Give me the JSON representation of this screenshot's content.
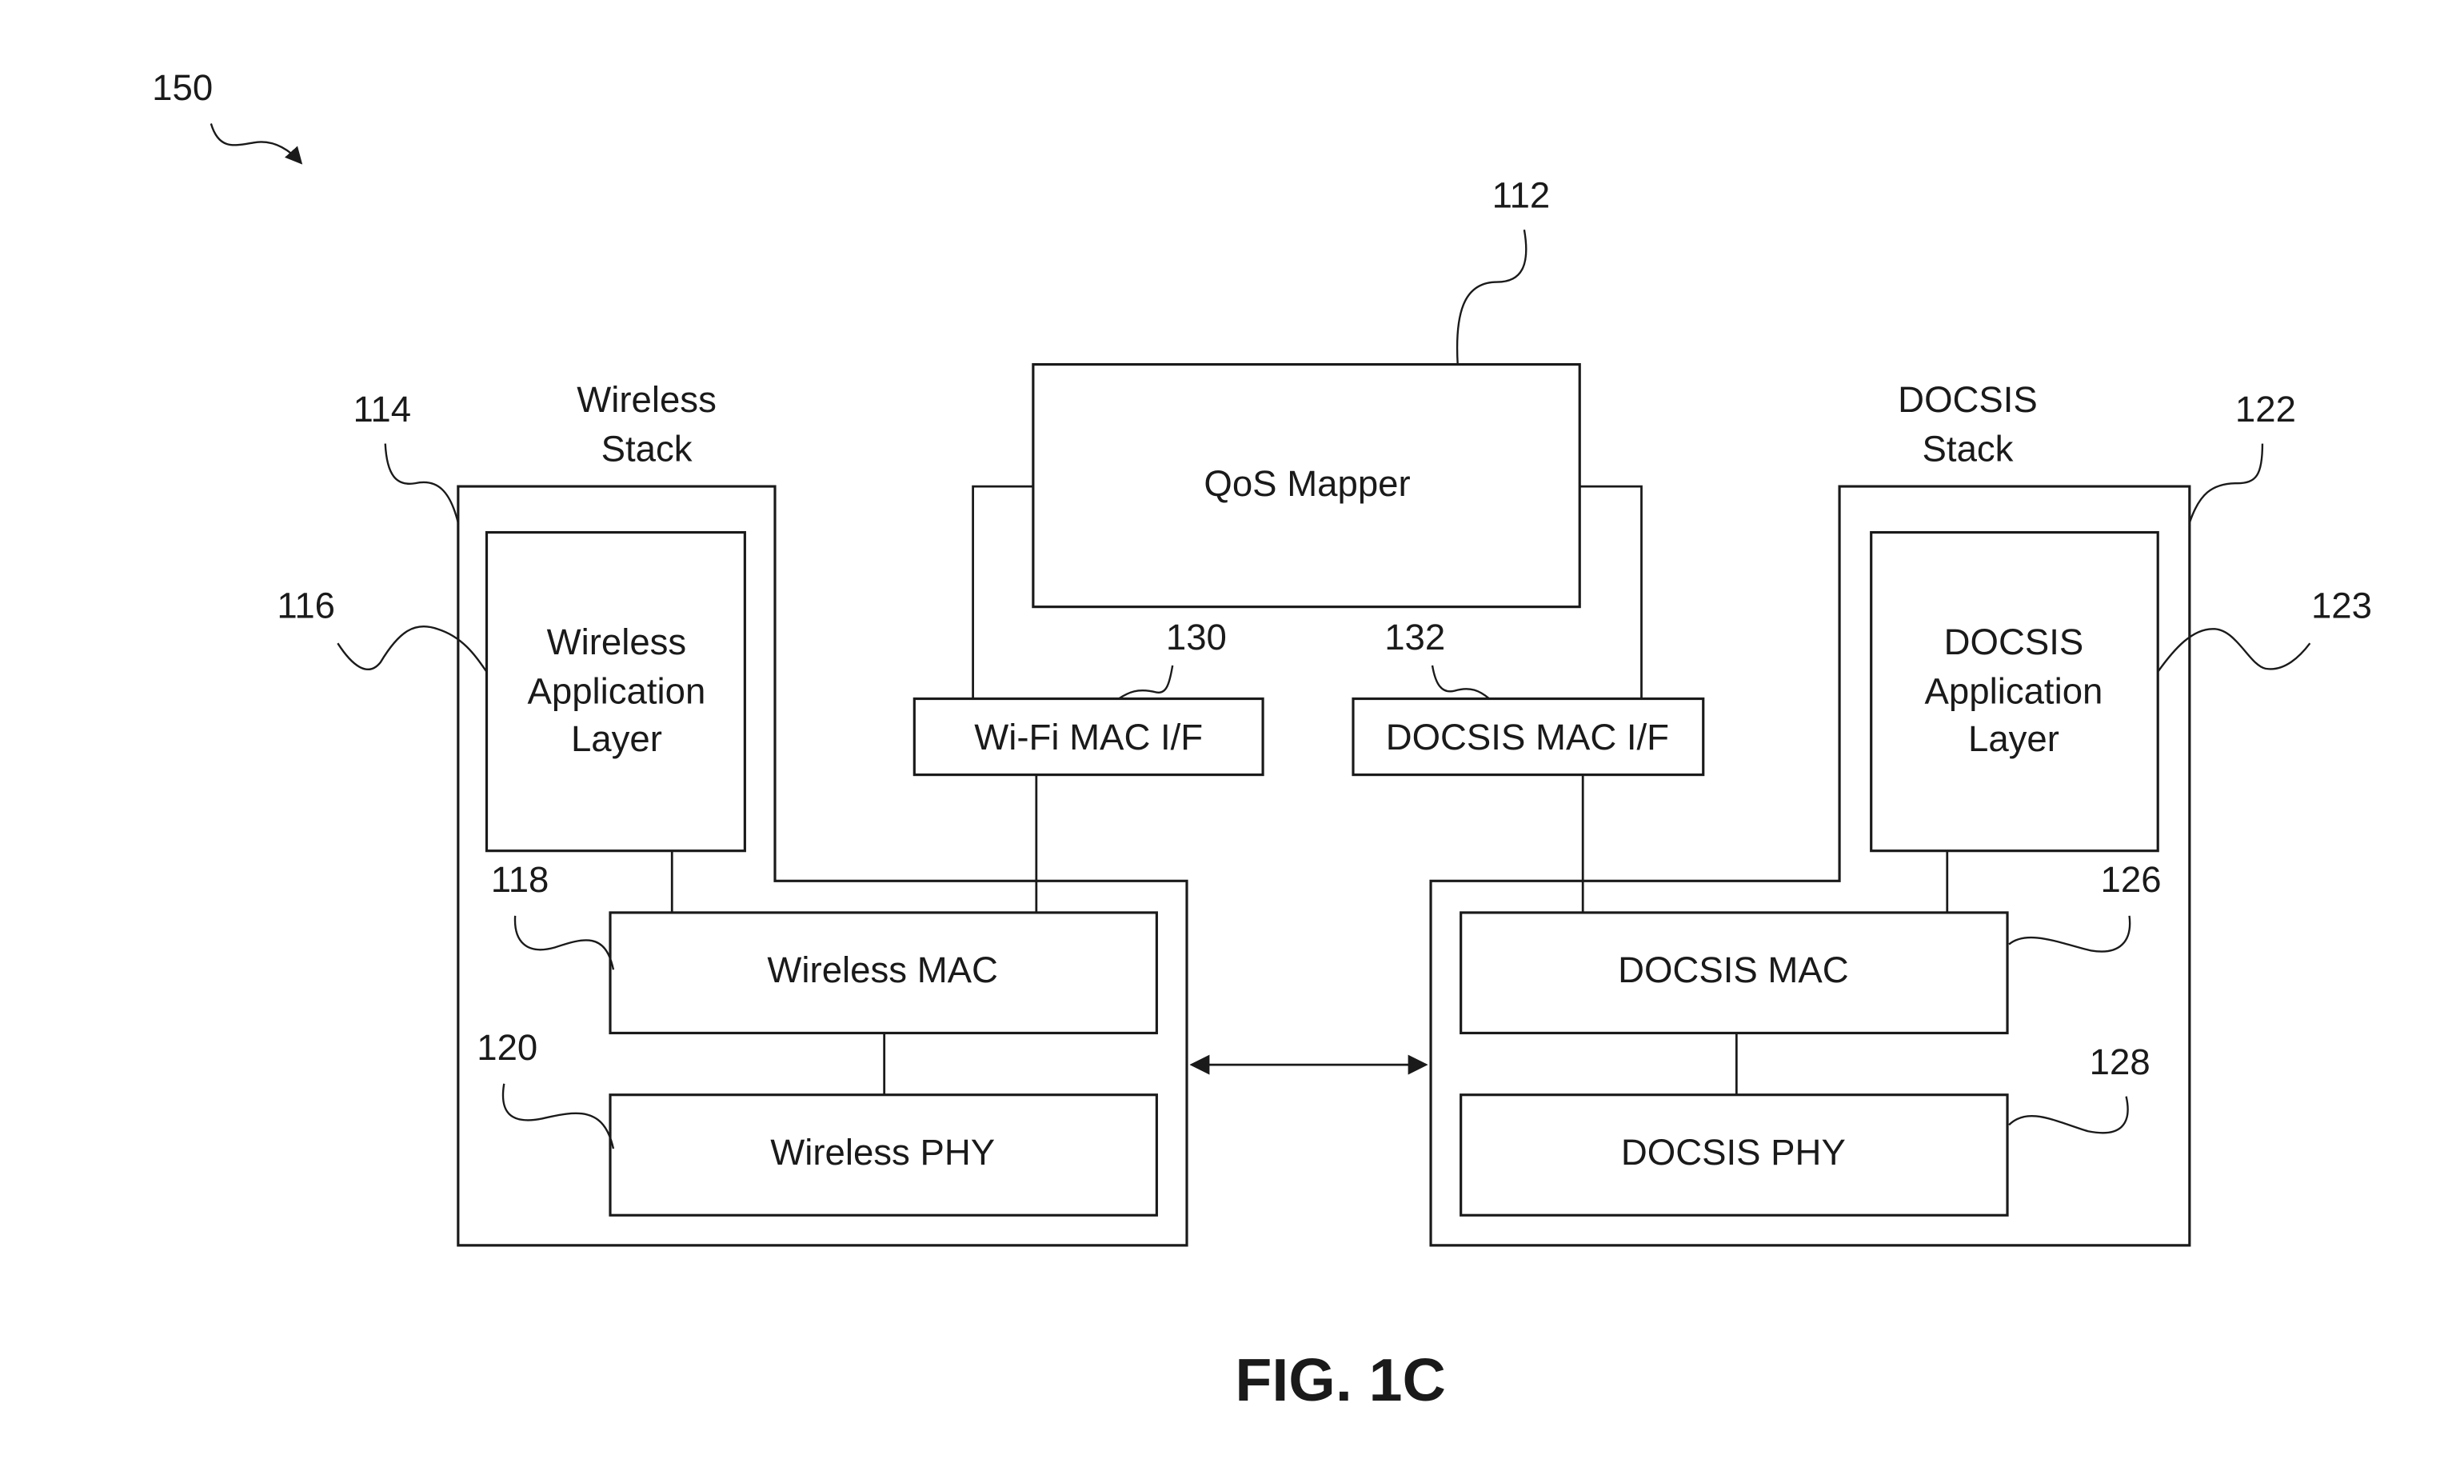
{
  "figure": {
    "caption": "FIG. 1C",
    "overall_ref": "150"
  },
  "qos_mapper": {
    "label": "QoS Mapper",
    "ref": "112"
  },
  "wifi_mac_if": {
    "label": "Wi-Fi MAC I/F",
    "ref": "130"
  },
  "docsis_mac_if": {
    "label": "DOCSIS MAC I/F",
    "ref": "132"
  },
  "wireless_stack": {
    "title_line1": "Wireless",
    "title_line2": "Stack",
    "ref": "114",
    "app_layer": {
      "line1": "Wireless",
      "line2": "Application",
      "line3": "Layer",
      "ref": "116"
    },
    "mac": {
      "label": "Wireless MAC",
      "ref": "118"
    },
    "phy": {
      "label": "Wireless PHY",
      "ref": "120"
    }
  },
  "docsis_stack": {
    "title_line1": "DOCSIS",
    "title_line2": "Stack",
    "ref": "122",
    "app_layer": {
      "line1": "DOCSIS",
      "line2": "Application",
      "line3": "Layer",
      "ref": "123"
    },
    "mac": {
      "label": "DOCSIS MAC",
      "ref": "126"
    },
    "phy": {
      "label": "DOCSIS PHY",
      "ref": "128"
    }
  }
}
